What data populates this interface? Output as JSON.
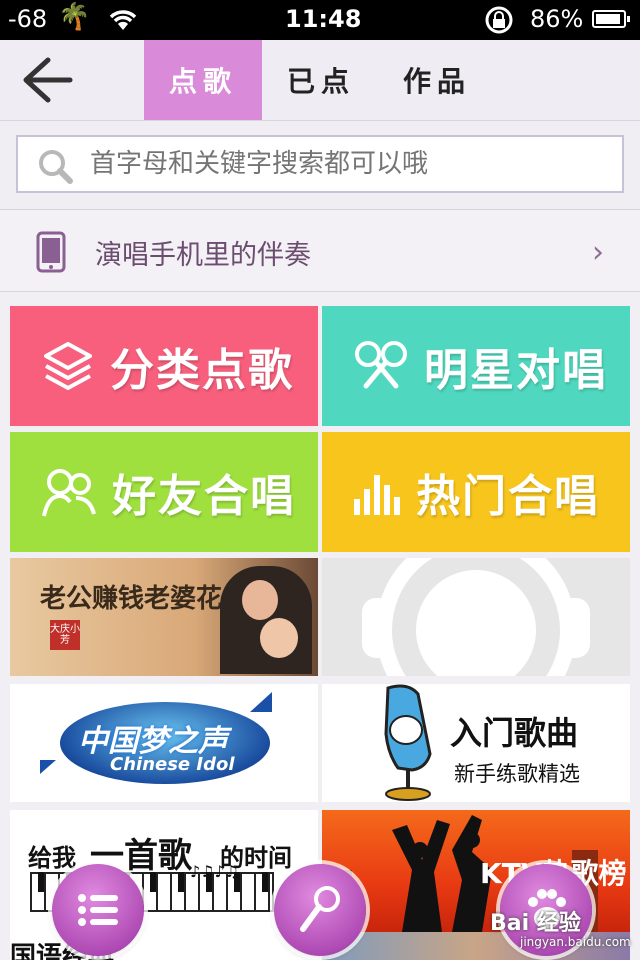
{
  "status_bar": {
    "signal": "-68",
    "time": "11:48",
    "battery": "86%"
  },
  "header": {
    "tabs": [
      {
        "label": "点歌",
        "active": true
      },
      {
        "label": "已点",
        "active": false
      },
      {
        "label": "作品",
        "active": false
      }
    ]
  },
  "search": {
    "placeholder": "首字母和关键字搜索都可以哦"
  },
  "accompaniment": {
    "label": "演唱手机里的伴奏"
  },
  "tiles": [
    {
      "label": "分类点歌",
      "color": "#f75f7c",
      "icon": "layers-icon"
    },
    {
      "label": "明星对唱",
      "color": "#4fd8bf",
      "icon": "duet-mic-icon"
    },
    {
      "label": "好友合唱",
      "color": "#9fe03f",
      "icon": "friends-icon"
    },
    {
      "label": "热门合唱",
      "color": "#f7c51b",
      "icon": "bar-chart-icon"
    }
  ],
  "cards": [
    {
      "title": "老公赚钱老婆花",
      "badge": "大庆小芳"
    },
    {
      "title": "",
      "note": "placeholder"
    },
    {
      "title": "中国梦之声",
      "subtitle": "Chinese Idol"
    },
    {
      "title": "入门歌曲",
      "subtitle": "新手练歌精选"
    },
    {
      "title_part1": "给我",
      "title_part2": "一首歌",
      "title_part3": "的时间"
    },
    {
      "title": "KTV热歌榜"
    }
  ],
  "bottom_partial": {
    "text": "国语经典"
  },
  "watermark": {
    "text": "Bai 经验",
    "url": "jingyan.baidu.com"
  },
  "colors": {
    "accent": "#d98ad8",
    "header_bg": "#efecf3"
  }
}
